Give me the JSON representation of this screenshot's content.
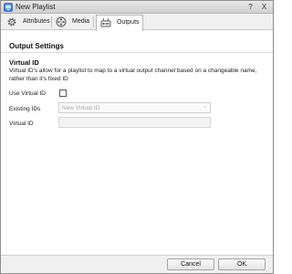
{
  "window": {
    "title": "New Playlist",
    "help_label": "?",
    "close_label": "X"
  },
  "tabs": [
    {
      "label": "Attributes",
      "icon": "gear-icon",
      "selected": false
    },
    {
      "label": "Media",
      "icon": "film-reel-icon",
      "selected": false
    },
    {
      "label": "Outputs",
      "icon": "output-device-icon",
      "selected": true
    }
  ],
  "content": {
    "section_title": "Output Settings",
    "group_title": "Virtual ID",
    "description": "Virtual ID's allow for a playlist to map to a virtual output channel based on a changeable name, rather than it's fixed ID",
    "use_virtual_id": {
      "label": "Use Virtual ID",
      "checked": false
    },
    "existing_ids": {
      "label": "Existing IDs",
      "selected_value": "New Virtual ID"
    },
    "virtual_id": {
      "label": "Virtual ID",
      "value": ""
    }
  },
  "footer": {
    "cancel_label": "Cancel",
    "ok_label": "OK"
  },
  "colors": {
    "titlebar": "#d8d8d8",
    "tabbar": "#f0f0f0",
    "footer": "#f0f0f0",
    "disabled_text": "#a8a8a8"
  }
}
